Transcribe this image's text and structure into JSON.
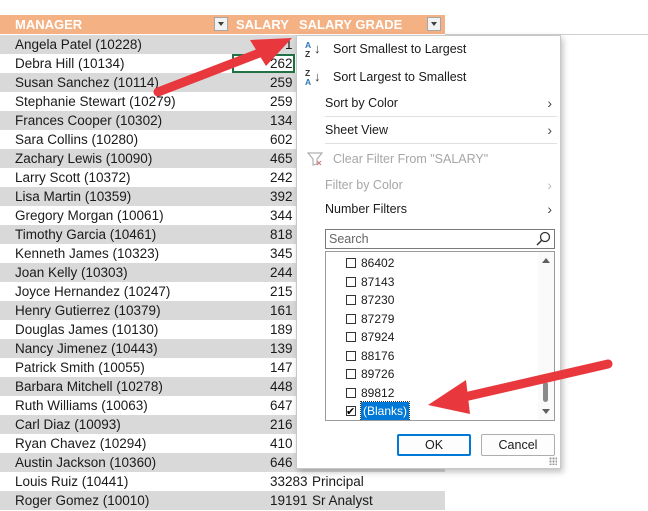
{
  "headers": {
    "manager": "MANAGER",
    "salary": "SALARY",
    "salary_grade": "SALARY GRADE"
  },
  "rows": [
    {
      "manager": "Angela Patel (10228)",
      "salary": "471",
      "grade": ""
    },
    {
      "manager": "Debra Hill (10134)",
      "salary": "262",
      "grade": ""
    },
    {
      "manager": "Susan Sanchez (10114)",
      "salary": "259",
      "grade": ""
    },
    {
      "manager": "Stephanie Stewart (10279)",
      "salary": "259",
      "grade": ""
    },
    {
      "manager": "Frances Cooper (10302)",
      "salary": "134",
      "grade": ""
    },
    {
      "manager": "Sara Collins (10280)",
      "salary": "602",
      "grade": ""
    },
    {
      "manager": "Zachary Lewis (10090)",
      "salary": "465",
      "grade": ""
    },
    {
      "manager": "Larry Scott (10372)",
      "salary": "242",
      "grade": ""
    },
    {
      "manager": "Lisa Martin (10359)",
      "salary": "392",
      "grade": ""
    },
    {
      "manager": "Gregory Morgan (10061)",
      "salary": "344",
      "grade": ""
    },
    {
      "manager": "Timothy Garcia (10461)",
      "salary": "818",
      "grade": ""
    },
    {
      "manager": "Kenneth James (10323)",
      "salary": "345",
      "grade": ""
    },
    {
      "manager": "Joan Kelly (10303)",
      "salary": "244",
      "grade": ""
    },
    {
      "manager": "Joyce Hernandez (10247)",
      "salary": "215",
      "grade": ""
    },
    {
      "manager": "Henry Gutierrez (10379)",
      "salary": "161",
      "grade": ""
    },
    {
      "manager": "Douglas James (10130)",
      "salary": "189",
      "grade": ""
    },
    {
      "manager": "Nancy Jimenez (10443)",
      "salary": "139",
      "grade": ""
    },
    {
      "manager": "Patrick Smith (10055)",
      "salary": "147",
      "grade": ""
    },
    {
      "manager": "Barbara Mitchell (10278)",
      "salary": "448",
      "grade": ""
    },
    {
      "manager": "Ruth Williams (10063)",
      "salary": "647",
      "grade": ""
    },
    {
      "manager": "Carl Diaz (10093)",
      "salary": "216",
      "grade": ""
    },
    {
      "manager": "Ryan Chavez (10294)",
      "salary": "410",
      "grade": ""
    },
    {
      "manager": "Austin Jackson (10360)",
      "salary": "646",
      "grade": ""
    },
    {
      "manager": "Louis Ruiz (10441)",
      "salary": "33283",
      "grade": "Principal"
    },
    {
      "manager": "Roger Gomez (10010)",
      "salary": "19191",
      "grade": "Sr Analyst"
    }
  ],
  "filter_menu": {
    "sort_asc": "Sort Smallest to Largest",
    "sort_desc": "Sort Largest to Smallest",
    "sort_by_color": "Sort by Color",
    "sheet_view": "Sheet View",
    "clear_filter": "Clear Filter From \"SALARY\"",
    "filter_by_color": "Filter by Color",
    "number_filters": "Number Filters",
    "search_placeholder": "Search",
    "values": [
      {
        "label": "86402",
        "checked": false
      },
      {
        "label": "87143",
        "checked": false
      },
      {
        "label": "87230",
        "checked": false
      },
      {
        "label": "87279",
        "checked": false
      },
      {
        "label": "87924",
        "checked": false
      },
      {
        "label": "88176",
        "checked": false
      },
      {
        "label": "89726",
        "checked": false
      },
      {
        "label": "89812",
        "checked": false
      },
      {
        "label": "(Blanks)",
        "checked": true
      }
    ],
    "ok": "OK",
    "cancel": "Cancel"
  },
  "colors": {
    "header_bg": "#f4b183",
    "band": "#d9d9d9",
    "arrow": "#e8383d",
    "selection": "#0078d7"
  },
  "icons": [
    "sort-asc-icon",
    "sort-desc-icon",
    "chevron-right-icon",
    "clear-filter-icon",
    "search-icon",
    "filter-dropdown-icon",
    "checkbox-icon",
    "red-arrow-annotation"
  ]
}
